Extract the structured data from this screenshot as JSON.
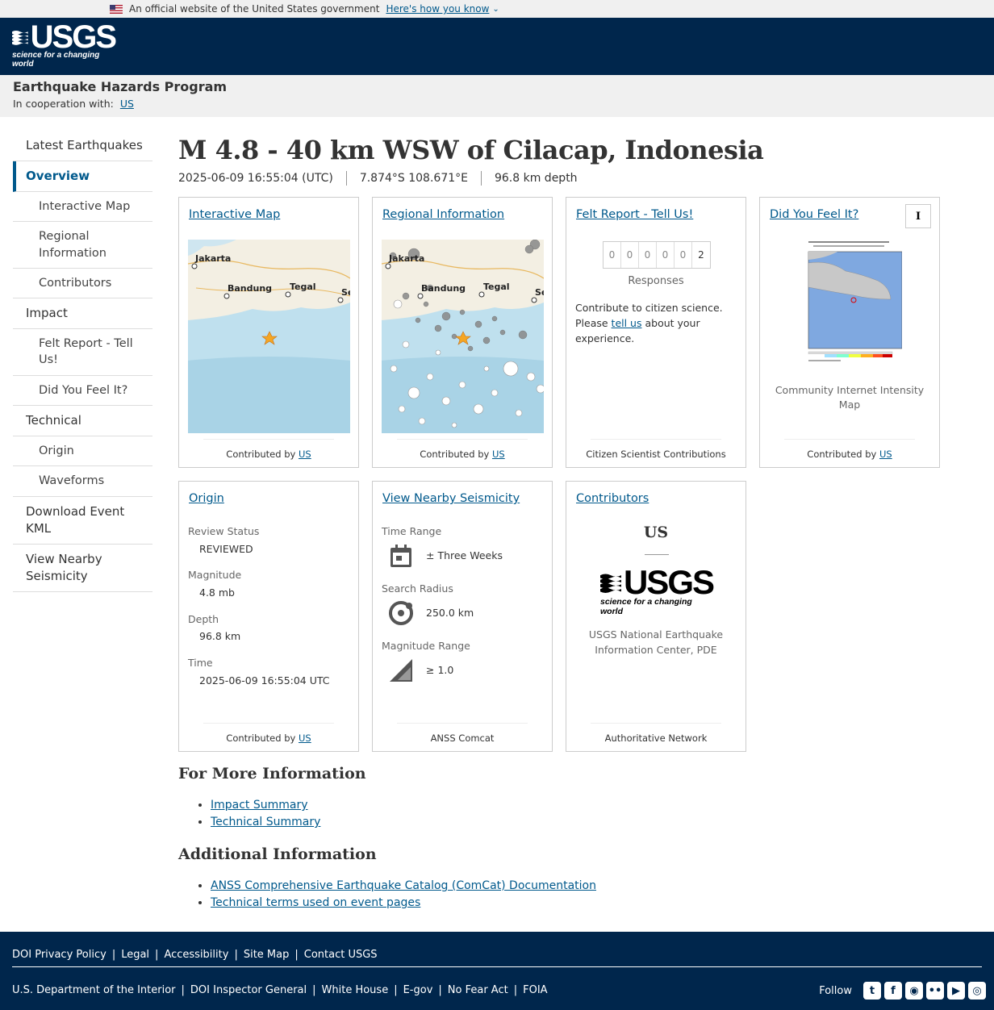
{
  "gov_banner": {
    "text": "An official website of the United States government",
    "how": "Here's how you know"
  },
  "logo": {
    "word": "USGS",
    "tagline": "science for a changing world"
  },
  "site": {
    "title": "Earthquake Hazards Program",
    "coop_label": "In cooperation with:",
    "coop_link": "US"
  },
  "sidebar": {
    "items": [
      {
        "label": "Latest Earthquakes"
      },
      {
        "label": "Overview"
      },
      {
        "label": "Interactive Map"
      },
      {
        "label": "Regional Information"
      },
      {
        "label": "Contributors"
      },
      {
        "label": "Impact"
      },
      {
        "label": "Felt Report - Tell Us!"
      },
      {
        "label": "Did You Feel It?"
      },
      {
        "label": "Technical"
      },
      {
        "label": "Origin"
      },
      {
        "label": "Waveforms"
      },
      {
        "label": "Download Event KML"
      },
      {
        "label": "View Nearby Seismicity"
      }
    ]
  },
  "event": {
    "title": "M 4.8 - 40 km WSW of Cilacap, Indonesia",
    "time": "2025-06-09 16:55:04 (UTC)",
    "location": "7.874°S 108.671°E",
    "depth": "96.8 km depth"
  },
  "cards": {
    "contributed_by": "Contributed by",
    "contributor_link": "US",
    "interactive_map": {
      "title": "Interactive Map",
      "labels": [
        "Jakarta",
        "Bandung",
        "Tegal",
        "Se"
      ]
    },
    "regional": {
      "title": "Regional Information",
      "labels": [
        "Jakarta",
        "Bandung",
        "Tegal",
        "Se"
      ]
    },
    "felt": {
      "title": "Felt Report - Tell Us!",
      "digits": [
        "0",
        "0",
        "0",
        "0",
        "0",
        "2"
      ],
      "responses": "Responses",
      "text_before": "Contribute to citizen science. Please ",
      "link": "tell us",
      "text_after": " about your experience.",
      "footer": "Citizen Scientist Contributions"
    },
    "dyfi": {
      "title": "Did You Feel It?",
      "button": "I",
      "caption": "Community Internet Intensity Map"
    },
    "origin": {
      "title": "Origin",
      "review_label": "Review Status",
      "review_value": "REVIEWED",
      "magnitude_label": "Magnitude",
      "magnitude_value": "4.8 mb",
      "depth_label": "Depth",
      "depth_value": "96.8 km",
      "time_label": "Time",
      "time_value": "2025-06-09 16:55:04 UTC"
    },
    "nearby": {
      "title": "View Nearby Seismicity",
      "time_label": "Time Range",
      "time_value": "± Three Weeks",
      "radius_label": "Search Radius",
      "radius_value": "250.0 km",
      "mag_label": "Magnitude Range",
      "mag_value": "≥ 1.0",
      "footer": "ANSS Comcat"
    },
    "contributors": {
      "title": "Contributors",
      "code": "US",
      "name": "USGS National Earthquake Information Center, PDE",
      "footer": "Authoritative Network"
    }
  },
  "more_info": {
    "heading": "For More Information",
    "links": [
      "Impact Summary",
      "Technical Summary"
    ]
  },
  "additional": {
    "heading": "Additional Information",
    "links": [
      "ANSS Comprehensive Earthquake Catalog (ComCat) Documentation",
      "Technical terms used on event pages"
    ]
  },
  "footer": {
    "row1": [
      "DOI Privacy Policy",
      "Legal",
      "Accessibility",
      "Site Map",
      "Contact USGS"
    ],
    "row2": [
      "U.S. Department of the Interior",
      "DOI Inspector General",
      "White House",
      "E-gov",
      "No Fear Act",
      "FOIA"
    ],
    "follow": "Follow"
  }
}
